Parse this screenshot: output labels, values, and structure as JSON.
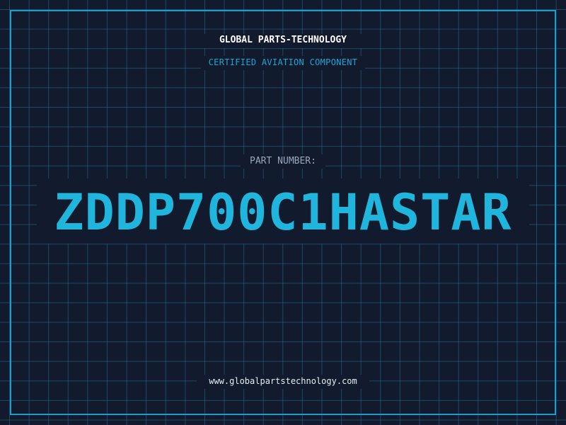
{
  "header": {
    "company": "GLOBAL PARTS-TECHNOLOGY",
    "tagline": "CERTIFIED AVIATION COMPONENT"
  },
  "part": {
    "label": "PART NUMBER:",
    "number": "ZDDP700C1HASTAR"
  },
  "footer": {
    "url": "www.globalpartstechnology.com"
  },
  "colors": {
    "background": "#121a2e",
    "grid": "#286e8c",
    "accent": "#1fb5dc",
    "frame": "#1e9ccc"
  }
}
